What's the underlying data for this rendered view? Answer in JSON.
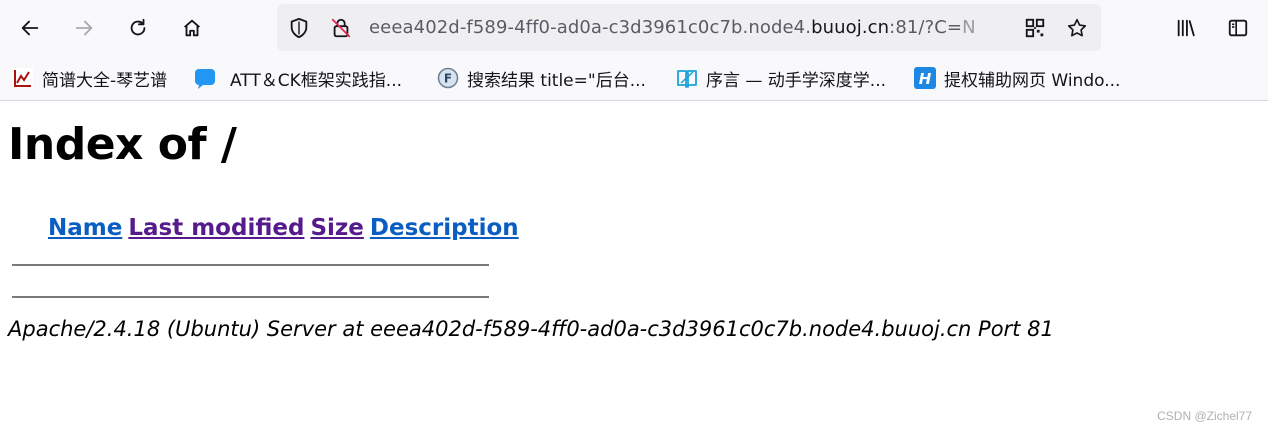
{
  "browser": {
    "url_prefix": "eeea402d-f589-4ff0-ad0a-c3d3961c0c7b.node4.",
    "url_host": "buuoj.cn",
    "url_suffix": ":81/?C=",
    "url_fade": "N"
  },
  "bookmarks": [
    {
      "label": "简谱大全-琴艺谱",
      "icon": "qinyipu-icon"
    },
    {
      "label": "ATT＆CK框架实践指...",
      "icon": "chat-bubble-icon"
    },
    {
      "label": "搜索结果 title=\"后台...",
      "icon": "fofa-icon"
    },
    {
      "label": "序言 — 动手学深度学...",
      "icon": "book-icon"
    },
    {
      "label": "提权辅助网页 Windo...",
      "icon": "h-icon"
    }
  ],
  "page": {
    "heading": "Index of /",
    "columns": [
      {
        "label": "Name",
        "visited": false
      },
      {
        "label": "Last modified",
        "visited": true
      },
      {
        "label": "Size",
        "visited": true
      },
      {
        "label": "Description",
        "visited": false
      }
    ],
    "server_signature": "Apache/2.4.18 (Ubuntu) Server at eeea402d-f589-4ff0-ad0a-c3d3961c0c7b.node4.buuoj.cn Port 81"
  },
  "watermark": "CSDN @Zichel77",
  "colors": {
    "link_unvisited": "#0a5dc2",
    "link_visited": "#551a8b"
  }
}
